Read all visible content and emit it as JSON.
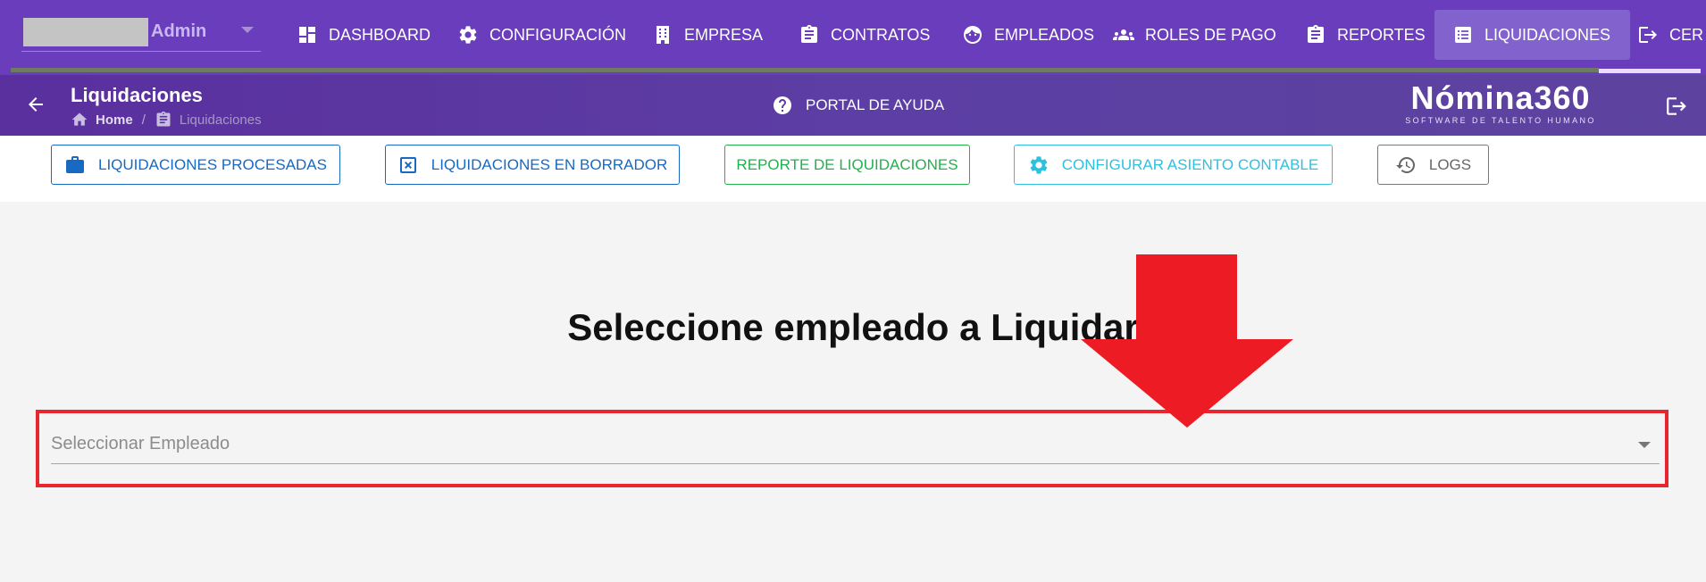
{
  "colors": {
    "topbar": "#6a3dbd",
    "nav_active": "#8262cd",
    "subbar": "#5c3ea4",
    "primary_blue": "#1769c2",
    "success_green": "#22b14c",
    "info_cyan": "#2ec1df",
    "annotation_red": "#e8262d"
  },
  "user": {
    "name": "Admin"
  },
  "nav": {
    "items": [
      {
        "label": "DASHBOARD",
        "icon": "dashboard-icon"
      },
      {
        "label": "CONFIGURACIÓN",
        "icon": "gear-icon"
      },
      {
        "label": "EMPRESA",
        "icon": "building-icon"
      },
      {
        "label": "CONTRATOS",
        "icon": "clipboard-icon"
      },
      {
        "label": "EMPLEADOS",
        "icon": "face-icon"
      },
      {
        "label": "ROLES DE PAGO",
        "icon": "group-icon"
      },
      {
        "label": "REPORTES",
        "icon": "clipboard-icon"
      },
      {
        "label": "LIQUIDACIONES",
        "icon": "list-icon",
        "active": true
      },
      {
        "label": "CER",
        "icon": "logout-icon"
      }
    ]
  },
  "header": {
    "title": "Liquidaciones",
    "breadcrumb": {
      "home": "Home",
      "separator": "/",
      "current": "Liquidaciones"
    },
    "help_label": "PORTAL DE AYUDA",
    "logo": {
      "main": "Nómina360",
      "sub": "SOFTWARE DE TALENTO HUMANO"
    }
  },
  "actions": {
    "processed": "LIQUIDACIONES PROCESADAS",
    "drafts": "LIQUIDACIONES EN BORRADOR",
    "report": "REPORTE DE LIQUIDACIONES",
    "config_accounting": "CONFIGURAR ASIENTO CONTABLE",
    "logs": "LOGS"
  },
  "main": {
    "title": "Seleccione empleado a Liquidar",
    "select": {
      "placeholder": "Seleccionar Empleado"
    }
  }
}
